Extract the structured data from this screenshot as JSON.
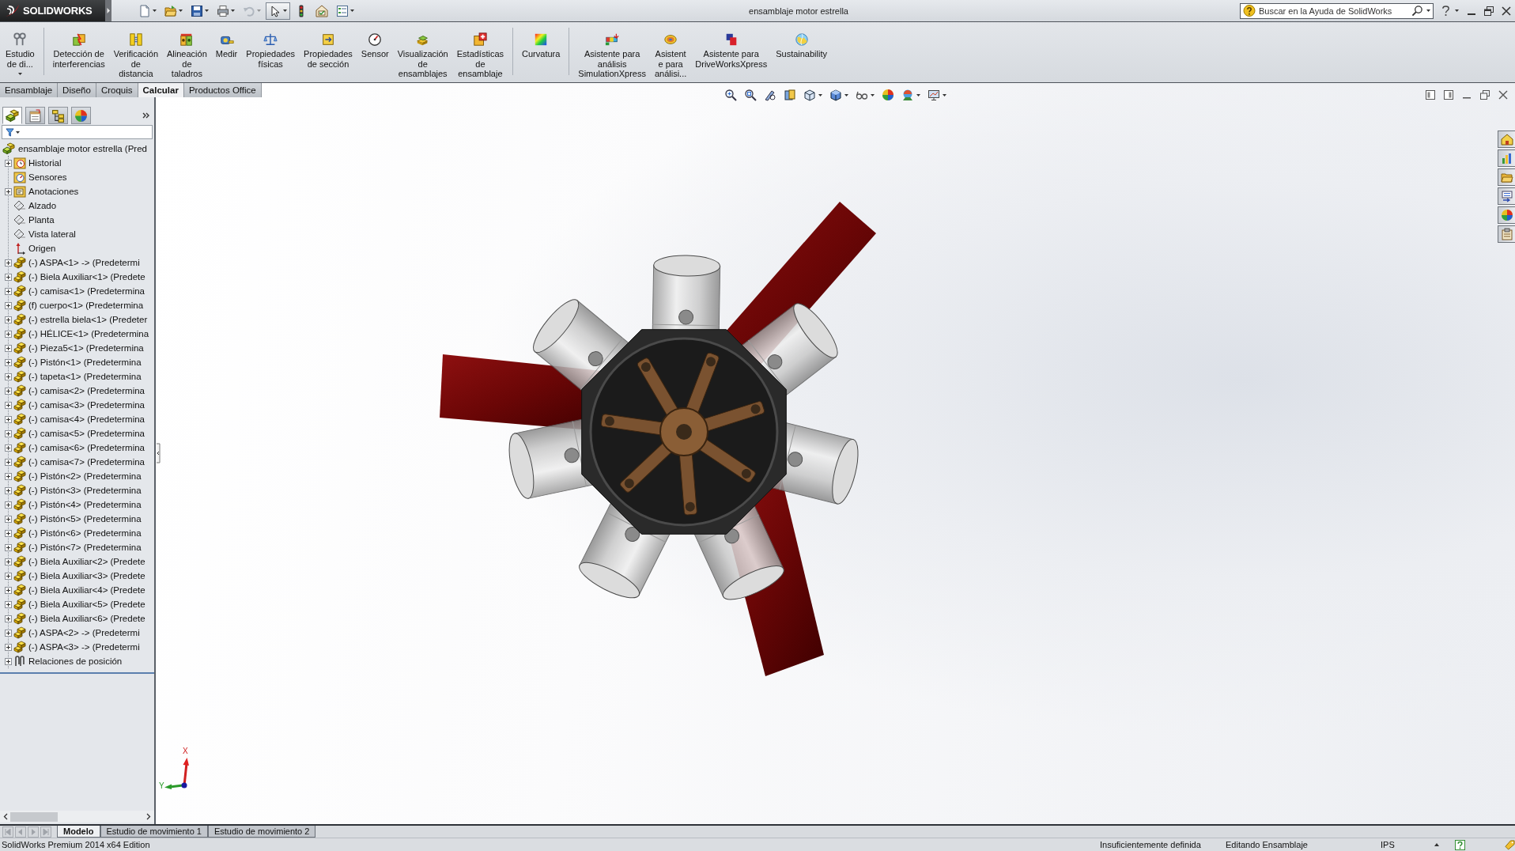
{
  "app": {
    "logo": "SOLIDWORKS",
    "title": "ensamblaje motor estrella"
  },
  "quick_access": [
    {
      "dropdown": true,
      "disabled": false,
      "pressed": false
    },
    {
      "dropdown": true,
      "disabled": false,
      "pressed": false
    },
    {
      "dropdown": true,
      "disabled": false,
      "pressed": false
    },
    {
      "dropdown": true,
      "disabled": false,
      "pressed": false
    },
    {
      "dropdown": true,
      "disabled": true,
      "pressed": false
    },
    {
      "dropdown": true,
      "disabled": false,
      "pressed": true
    },
    {
      "dropdown": false,
      "disabled": false,
      "pressed": false
    },
    {
      "dropdown": false,
      "disabled": false,
      "pressed": false
    },
    {
      "dropdown": true,
      "disabled": false,
      "pressed": false
    }
  ],
  "help_search": {
    "placeholder": "Buscar en la Ayuda de SolidWorks"
  },
  "command_manager": {
    "buttons": [
      {
        "label_lines": [
          "Estudio",
          "de di..."
        ],
        "dropdown": true,
        "separator_after": true
      },
      {
        "label_lines": [
          "Detección de",
          "interferencias"
        ],
        "dropdown": false,
        "separator_after": false
      },
      {
        "label_lines": [
          "Verificación",
          "de",
          "distancia"
        ],
        "dropdown": false,
        "separator_after": false
      },
      {
        "label_lines": [
          "Alineación",
          "de",
          "taladros"
        ],
        "dropdown": false,
        "separator_after": false
      },
      {
        "label_lines": [
          "Medir"
        ],
        "dropdown": false,
        "separator_after": false
      },
      {
        "label_lines": [
          "Propiedades",
          "físicas"
        ],
        "dropdown": false,
        "separator_after": false
      },
      {
        "label_lines": [
          "Propiedades",
          "de sección"
        ],
        "dropdown": false,
        "separator_after": false
      },
      {
        "label_lines": [
          "Sensor"
        ],
        "dropdown": false,
        "separator_after": false
      },
      {
        "label_lines": [
          "Visualización",
          "de",
          "ensamblajes"
        ],
        "dropdown": false,
        "separator_after": false
      },
      {
        "label_lines": [
          "Estadísticas",
          "de",
          "ensamblaje"
        ],
        "dropdown": false,
        "separator_after": true
      },
      {
        "label_lines": [
          "Curvatura"
        ],
        "dropdown": false,
        "separator_after": true
      },
      {
        "label_lines": [
          "Asistente para",
          "análisis",
          "SimulationXpress"
        ],
        "dropdown": false,
        "separator_after": false
      },
      {
        "label_lines": [
          "Asistent",
          "e para",
          "análisi..."
        ],
        "dropdown": false,
        "separator_after": false
      },
      {
        "label_lines": [
          "Asistente para",
          "DriveWorksXpress"
        ],
        "dropdown": false,
        "separator_after": false
      },
      {
        "label_lines": [
          "Sustainability"
        ],
        "dropdown": false,
        "separator_after": false
      }
    ]
  },
  "command_tabs": [
    {
      "label": "Ensamblaje",
      "selected": false
    },
    {
      "label": "Diseño",
      "selected": false
    },
    {
      "label": "Croquis",
      "selected": false
    },
    {
      "label": "Calcular",
      "selected": true
    },
    {
      "label": "Productos Office",
      "selected": false
    }
  ],
  "feature_manager": {
    "panel_tabs": [
      {
        "selected": true
      },
      {
        "selected": false
      },
      {
        "selected": false
      },
      {
        "selected": false
      }
    ],
    "tree": {
      "label": "ensamblaje motor estrella (Pred",
      "kind": "assembly",
      "children": [
        {
          "label": "Historial",
          "kind": "history",
          "expanded": false
        },
        {
          "label": "Sensores",
          "kind": "sensors"
        },
        {
          "label": "Anotaciones",
          "kind": "annotations",
          "expanded": false
        },
        {
          "label": "Alzado",
          "kind": "plane"
        },
        {
          "label": "Planta",
          "kind": "plane"
        },
        {
          "label": "Vista lateral",
          "kind": "plane"
        },
        {
          "label": "Origen",
          "kind": "origin"
        },
        {
          "label": "(-) ASPA<1> -> (Predetermi",
          "kind": "component",
          "expanded": false
        },
        {
          "label": "(-) Biela Auxiliar<1> (Predete",
          "kind": "component",
          "expanded": false
        },
        {
          "label": "(-) camisa<1> (Predetermina",
          "kind": "component",
          "expanded": false
        },
        {
          "label": "(f) cuerpo<1> (Predetermina",
          "kind": "component",
          "expanded": false
        },
        {
          "label": "(-) estrella biela<1> (Predeter",
          "kind": "component",
          "expanded": false
        },
        {
          "label": "(-) HÉLICE<1> (Predetermina",
          "kind": "component",
          "expanded": false
        },
        {
          "label": "(-) Pieza5<1> (Predetermina",
          "kind": "component",
          "expanded": false
        },
        {
          "label": "(-) Pistón<1> (Predetermina",
          "kind": "component",
          "expanded": false
        },
        {
          "label": "(-) tapeta<1> (Predetermina",
          "kind": "component",
          "expanded": false
        },
        {
          "label": "(-) camisa<2> (Predetermina",
          "kind": "component",
          "expanded": false
        },
        {
          "label": "(-) camisa<3> (Predetermina",
          "kind": "component",
          "expanded": false
        },
        {
          "label": "(-) camisa<4> (Predetermina",
          "kind": "component",
          "expanded": false
        },
        {
          "label": "(-) camisa<5> (Predetermina",
          "kind": "component",
          "expanded": false
        },
        {
          "label": "(-) camisa<6> (Predetermina",
          "kind": "component",
          "expanded": false
        },
        {
          "label": "(-) camisa<7> (Predetermina",
          "kind": "component",
          "expanded": false
        },
        {
          "label": "(-) Pistón<2> (Predetermina",
          "kind": "component",
          "expanded": false
        },
        {
          "label": "(-) Pistón<3> (Predetermina",
          "kind": "component",
          "expanded": false
        },
        {
          "label": "(-) Pistón<4> (Predetermina",
          "kind": "component",
          "expanded": false
        },
        {
          "label": "(-) Pistón<5> (Predetermina",
          "kind": "component",
          "expanded": false
        },
        {
          "label": "(-) Pistón<6> (Predetermina",
          "kind": "component",
          "expanded": false
        },
        {
          "label": "(-) Pistón<7> (Predetermina",
          "kind": "component",
          "expanded": false
        },
        {
          "label": "(-) Biela Auxiliar<2> (Predete",
          "kind": "component",
          "expanded": false
        },
        {
          "label": "(-) Biela Auxiliar<3> (Predete",
          "kind": "component",
          "expanded": false
        },
        {
          "label": "(-) Biela Auxiliar<4> (Predete",
          "kind": "component",
          "expanded": false
        },
        {
          "label": "(-) Biela Auxiliar<5> (Predete",
          "kind": "component",
          "expanded": false
        },
        {
          "label": "(-) Biela Auxiliar<6> (Predete",
          "kind": "component",
          "expanded": false
        },
        {
          "label": "(-) ASPA<2> -> (Predetermi",
          "kind": "component",
          "expanded": false
        },
        {
          "label": "(-) ASPA<3> -> (Predetermi",
          "kind": "component",
          "expanded": false
        },
        {
          "label": "Relaciones de posición",
          "kind": "mates",
          "expanded": false
        }
      ]
    }
  },
  "view_toolbar": [
    {
      "dropdown": false
    },
    {
      "dropdown": false
    },
    {
      "dropdown": false
    },
    {
      "dropdown": false
    },
    {
      "dropdown": true
    },
    {
      "dropdown": true
    },
    {
      "dropdown": true
    },
    {
      "dropdown": false
    },
    {
      "dropdown": true
    },
    {
      "dropdown": true
    }
  ],
  "graphics_area": {
    "triad": {
      "x_label": "X",
      "y_label": "Y"
    }
  },
  "bottom_tabs": [
    {
      "label": "Modelo",
      "selected": true
    },
    {
      "label": "Estudio de movimiento 1",
      "selected": false
    },
    {
      "label": "Estudio de movimiento 2",
      "selected": false
    }
  ],
  "status_bar": {
    "edition": "SolidWorks Premium 2014 x64 Edition",
    "panes": [
      "Insuficientemente definida",
      "Editando Ensamblaje",
      "IPS"
    ]
  }
}
